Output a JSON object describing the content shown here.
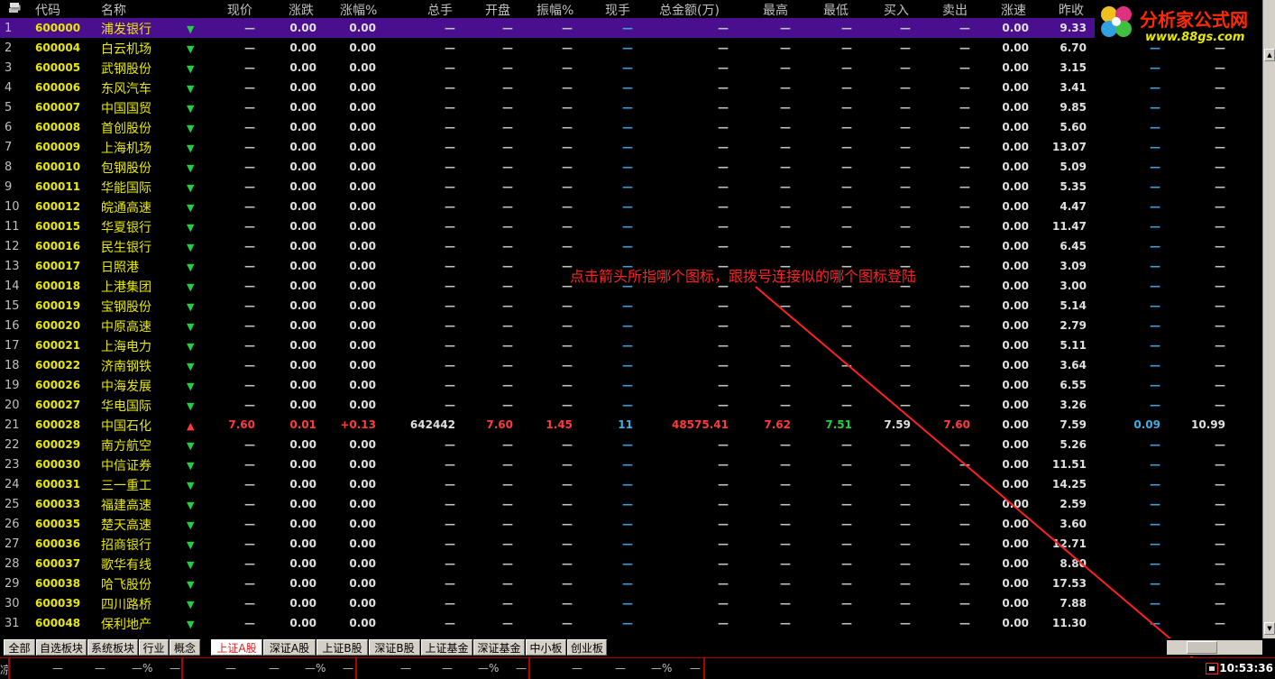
{
  "header": {
    "cols": [
      "代码",
      "名称",
      "现价",
      "涨跌",
      "涨幅%",
      "总手",
      "开盘",
      "振幅%",
      "现手",
      "总金额(万)",
      "最高",
      "最低",
      "买入",
      "卖出",
      "涨速",
      "昨收"
    ]
  },
  "rows": [
    {
      "idx": "1",
      "code": "600000",
      "name": "浦发银行",
      "dir": "down",
      "change": "0.00",
      "pct": "0.00",
      "speed": "0.00",
      "prev": "9.33",
      "selected": true
    },
    {
      "idx": "2",
      "code": "600004",
      "name": "白云机场",
      "dir": "down",
      "change": "0.00",
      "pct": "0.00",
      "speed": "0.00",
      "prev": "6.70"
    },
    {
      "idx": "3",
      "code": "600005",
      "name": "武钢股份",
      "dir": "down",
      "change": "0.00",
      "pct": "0.00",
      "speed": "0.00",
      "prev": "3.15"
    },
    {
      "idx": "4",
      "code": "600006",
      "name": "东风汽车",
      "dir": "down",
      "change": "0.00",
      "pct": "0.00",
      "speed": "0.00",
      "prev": "3.41"
    },
    {
      "idx": "5",
      "code": "600007",
      "name": "中国国贸",
      "dir": "down",
      "change": "0.00",
      "pct": "0.00",
      "speed": "0.00",
      "prev": "9.85"
    },
    {
      "idx": "6",
      "code": "600008",
      "name": "首创股份",
      "dir": "down",
      "change": "0.00",
      "pct": "0.00",
      "speed": "0.00",
      "prev": "5.60"
    },
    {
      "idx": "7",
      "code": "600009",
      "name": "上海机场",
      "dir": "down",
      "change": "0.00",
      "pct": "0.00",
      "speed": "0.00",
      "prev": "13.07"
    },
    {
      "idx": "8",
      "code": "600010",
      "name": "包钢股份",
      "dir": "down",
      "change": "0.00",
      "pct": "0.00",
      "speed": "0.00",
      "prev": "5.09"
    },
    {
      "idx": "9",
      "code": "600011",
      "name": "华能国际",
      "dir": "down",
      "change": "0.00",
      "pct": "0.00",
      "speed": "0.00",
      "prev": "5.35"
    },
    {
      "idx": "10",
      "code": "600012",
      "name": "皖通高速",
      "dir": "down",
      "change": "0.00",
      "pct": "0.00",
      "speed": "0.00",
      "prev": "4.47"
    },
    {
      "idx": "11",
      "code": "600015",
      "name": "华夏银行",
      "dir": "down",
      "change": "0.00",
      "pct": "0.00",
      "speed": "0.00",
      "prev": "11.47"
    },
    {
      "idx": "12",
      "code": "600016",
      "name": "民生银行",
      "dir": "down",
      "change": "0.00",
      "pct": "0.00",
      "speed": "0.00",
      "prev": "6.45"
    },
    {
      "idx": "13",
      "code": "600017",
      "name": "日照港",
      "dir": "down",
      "change": "0.00",
      "pct": "0.00",
      "speed": "0.00",
      "prev": "3.09"
    },
    {
      "idx": "14",
      "code": "600018",
      "name": "上港集团",
      "dir": "down",
      "change": "0.00",
      "pct": "0.00",
      "speed": "0.00",
      "prev": "3.00"
    },
    {
      "idx": "15",
      "code": "600019",
      "name": "宝钢股份",
      "dir": "down",
      "change": "0.00",
      "pct": "0.00",
      "speed": "0.00",
      "prev": "5.14"
    },
    {
      "idx": "16",
      "code": "600020",
      "name": "中原高速",
      "dir": "down",
      "change": "0.00",
      "pct": "0.00",
      "speed": "0.00",
      "prev": "2.79"
    },
    {
      "idx": "17",
      "code": "600021",
      "name": "上海电力",
      "dir": "down",
      "change": "0.00",
      "pct": "0.00",
      "speed": "0.00",
      "prev": "5.11"
    },
    {
      "idx": "18",
      "code": "600022",
      "name": "济南钢铁",
      "dir": "down",
      "change": "0.00",
      "pct": "0.00",
      "speed": "0.00",
      "prev": "3.64"
    },
    {
      "idx": "19",
      "code": "600026",
      "name": "中海发展",
      "dir": "down",
      "change": "0.00",
      "pct": "0.00",
      "speed": "0.00",
      "prev": "6.55"
    },
    {
      "idx": "20",
      "code": "600027",
      "name": "华电国际",
      "dir": "down",
      "change": "0.00",
      "pct": "0.00",
      "speed": "0.00",
      "prev": "3.26"
    },
    {
      "idx": "21",
      "code": "600028",
      "name": "中国石化",
      "dir": "up",
      "price": "7.60",
      "change": "0.01",
      "pct": "+0.13",
      "volume": "642442",
      "open": "7.60",
      "amplitude": "1.45",
      "cur": "11",
      "amount": "48575.41",
      "high": "7.62",
      "low": "7.51",
      "bid": "7.59",
      "ask": "7.60",
      "speed": "0.00",
      "prev": "7.59",
      "extra1": "0.09",
      "extra2": "10.99"
    },
    {
      "idx": "22",
      "code": "600029",
      "name": "南方航空",
      "dir": "down",
      "change": "0.00",
      "pct": "0.00",
      "speed": "0.00",
      "prev": "5.26"
    },
    {
      "idx": "23",
      "code": "600030",
      "name": "中信证券",
      "dir": "down",
      "change": "0.00",
      "pct": "0.00",
      "speed": "0.00",
      "prev": "11.51"
    },
    {
      "idx": "24",
      "code": "600031",
      "name": "三一重工",
      "dir": "down",
      "change": "0.00",
      "pct": "0.00",
      "speed": "0.00",
      "prev": "14.25"
    },
    {
      "idx": "25",
      "code": "600033",
      "name": "福建高速",
      "dir": "down",
      "change": "0.00",
      "pct": "0.00",
      "speed": "0.00",
      "prev": "2.59"
    },
    {
      "idx": "26",
      "code": "600035",
      "name": "楚天高速",
      "dir": "down",
      "change": "0.00",
      "pct": "0.00",
      "speed": "0.00",
      "prev": "3.60"
    },
    {
      "idx": "27",
      "code": "600036",
      "name": "招商银行",
      "dir": "down",
      "change": "0.00",
      "pct": "0.00",
      "speed": "0.00",
      "prev": "12.71"
    },
    {
      "idx": "28",
      "code": "600037",
      "name": "歌华有线",
      "dir": "down",
      "change": "0.00",
      "pct": "0.00",
      "speed": "0.00",
      "prev": "8.80"
    },
    {
      "idx": "29",
      "code": "600038",
      "name": "哈飞股份",
      "dir": "down",
      "change": "0.00",
      "pct": "0.00",
      "speed": "0.00",
      "prev": "17.53"
    },
    {
      "idx": "30",
      "code": "600039",
      "name": "四川路桥",
      "dir": "down",
      "change": "0.00",
      "pct": "0.00",
      "speed": "0.00",
      "prev": "7.88"
    },
    {
      "idx": "31",
      "code": "600048",
      "name": "保利地产",
      "dir": "down",
      "change": "0.00",
      "pct": "0.00",
      "speed": "0.00",
      "prev": "11.30"
    }
  ],
  "dash": "—",
  "tabs": [
    "全部",
    "自选板块",
    "系统板块",
    "行业",
    "概念",
    "上证A股",
    "深证A股",
    "上证B股",
    "深证B股",
    "上证基金",
    "深证基金",
    "中小板",
    "创业板"
  ],
  "active_tab": "上证A股",
  "status": {
    "seg_dash": "—",
    "seg_pct": "—%",
    "clock": "10:53:36"
  },
  "annotation": "点击箭头所指哪个图标，跟拨号连接似的哪个图标登陆",
  "logo": {
    "name": "分析家公式网",
    "url": "www.88gs.com"
  },
  "colors": {
    "selected_row": "#4a0f8e",
    "code": "#e8e800",
    "up": "#ff3a3a",
    "down": "#20d040",
    "annot": "#ff2020"
  }
}
